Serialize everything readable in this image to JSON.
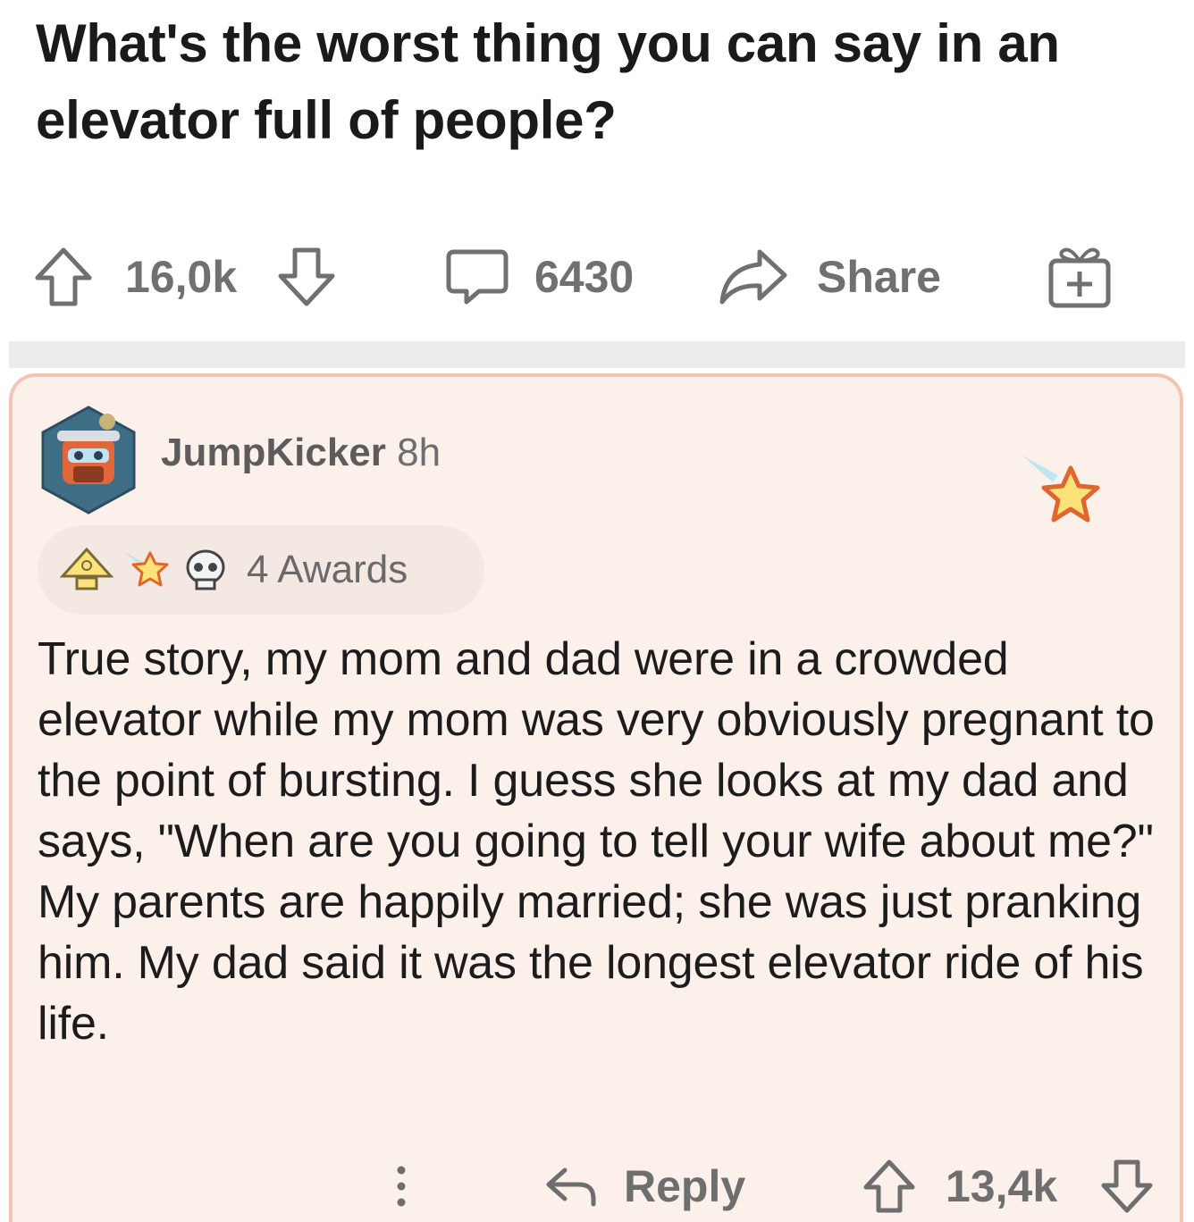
{
  "post": {
    "title": "What's the worst thing you can say in an elevator full of people?",
    "upvotes": "16,0k",
    "comments": "6430",
    "share_label": "Share"
  },
  "comment": {
    "username": "JumpKicker",
    "age": "8h",
    "awards_label": "4 Awards",
    "body": "True story, my mom and dad were in a crowded elevator while my mom was very obviously pregnant to the point of bursting. I guess she looks at my dad and says, \"When are you going to tell your wife about me?\" My parents are happily married; she was just pranking him. My dad said it was the longest elevator ride of his life.",
    "reply_label": "Reply",
    "votes": "13,4k"
  },
  "icons": {
    "upvote": "arrow-up-icon",
    "downvote": "arrow-down-icon",
    "comment": "speech-bubble-icon",
    "share": "share-arrow-icon",
    "award": "gift-icon",
    "more": "vertical-dots-icon",
    "reply": "reply-arrow-icon"
  },
  "colors": {
    "comment_background": "#fcf1ea",
    "comment_border": "#f1c4b4",
    "muted_text": "#6e6e6e"
  }
}
